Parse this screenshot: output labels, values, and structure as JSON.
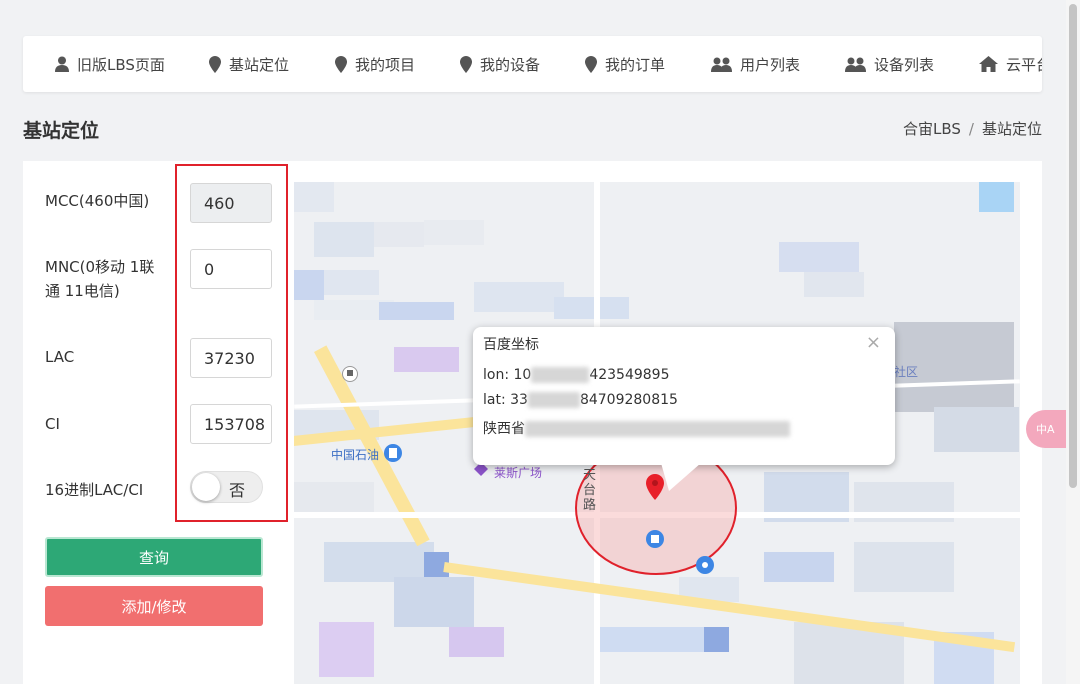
{
  "nav": {
    "items": [
      {
        "label": "旧版LBS页面",
        "icon": "user-icon"
      },
      {
        "label": "基站定位",
        "icon": "location-pin-icon"
      },
      {
        "label": "我的项目",
        "icon": "location-pin-icon"
      },
      {
        "label": "我的设备",
        "icon": "location-pin-icon"
      },
      {
        "label": "我的订单",
        "icon": "location-pin-icon"
      },
      {
        "label": "用户列表",
        "icon": "users-icon"
      },
      {
        "label": "设备列表",
        "icon": "users-icon"
      },
      {
        "label": "云平台主",
        "icon": "home-icon"
      }
    ]
  },
  "page": {
    "title": "基站定位",
    "breadcrumb": [
      "合宙LBS",
      "基站定位"
    ],
    "breadcrumb_sep": "/"
  },
  "form": {
    "mcc_label": "MCC(460中国)",
    "mcc_value": "460",
    "mnc_label_line1": "MNC(0移动 1联",
    "mnc_label_line2": "通 11电信)",
    "mnc_value": "0",
    "lac_label": "LAC",
    "lac_value": "37230",
    "ci_label": "CI",
    "ci_value": "153708",
    "hex_label": "16进制LAC/CI",
    "hex_toggle_text": "否",
    "query_button": "查询",
    "add_button": "添加/修改"
  },
  "map": {
    "popup": {
      "title": "百度坐标",
      "close": "×",
      "lon_prefix": "lon: 10",
      "lon_suffix": "423549895",
      "lat_prefix": "lat: 33",
      "lat_suffix": "84709280815",
      "address_prefix": "陕西省"
    },
    "labels": {
      "gas_station": "中国石油",
      "plaza": "莱斯广场",
      "road_1": "天",
      "road_2": "台",
      "road_3": "路",
      "district": "社区"
    }
  },
  "translate_tab": "中A",
  "colors": {
    "query_button": "#2da876",
    "add_button": "#f16f6f",
    "highlight_border": "#e0212b",
    "pin": "#e8202a"
  }
}
